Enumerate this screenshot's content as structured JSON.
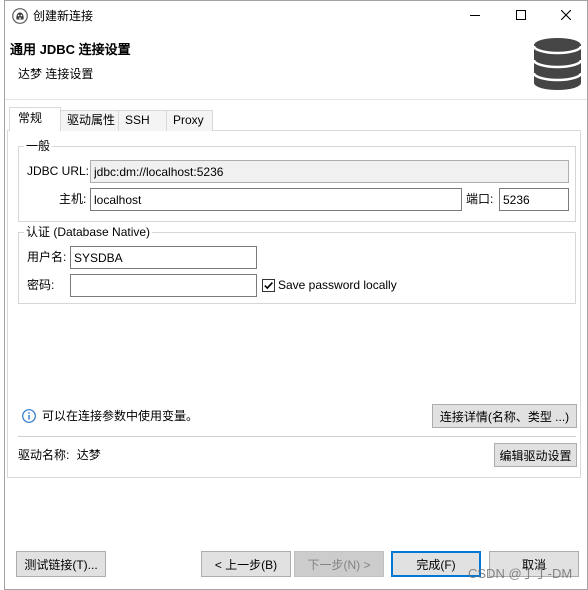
{
  "window": {
    "title": "创建新连接"
  },
  "header": {
    "title": "通用 JDBC 连接设置",
    "subtitle": "达梦 连接设置"
  },
  "tabs": [
    {
      "label": "常规",
      "selected": true
    },
    {
      "label": "驱动属性",
      "selected": false
    },
    {
      "label": "SSH",
      "selected": false
    },
    {
      "label": "Proxy",
      "selected": false
    }
  ],
  "general": {
    "legend": "一般",
    "jdbc_url_label": "JDBC URL:",
    "jdbc_url_value": "jdbc:dm://localhost:5236",
    "host_label": "主机:",
    "host_value": "localhost",
    "port_label": "端口:",
    "port_value": "5236"
  },
  "auth": {
    "legend": "认证 (Database Native)",
    "username_label": "用户名:",
    "username_value": "SYSDBA",
    "password_label": "密码:",
    "password_value": "",
    "save_password_label": "Save password locally",
    "save_password_checked": true
  },
  "info": {
    "text": "可以在连接参数中使用变量。",
    "details_button": "连接详情(名称、类型 ...)"
  },
  "driver": {
    "label": "驱动名称:",
    "name": "达梦",
    "edit_button": "编辑驱动设置"
  },
  "buttons": {
    "test": "测试链接(T)...",
    "back": "< 上一步(B)",
    "next": "下一步(N) >",
    "finish": "完成(F)",
    "cancel": "取消"
  },
  "watermark": "CSDN @丁丁-DM",
  "icons": {
    "app": "dbeaver-icon",
    "minimize": "minimize-icon",
    "maximize": "maximize-icon",
    "close": "close-icon",
    "header": "database-icon",
    "info": "info-icon",
    "checkbox": "checkmark-icon"
  },
  "colors": {
    "accent": "#0078d7",
    "info": "#2b78d0",
    "database_icon": "#454545"
  }
}
